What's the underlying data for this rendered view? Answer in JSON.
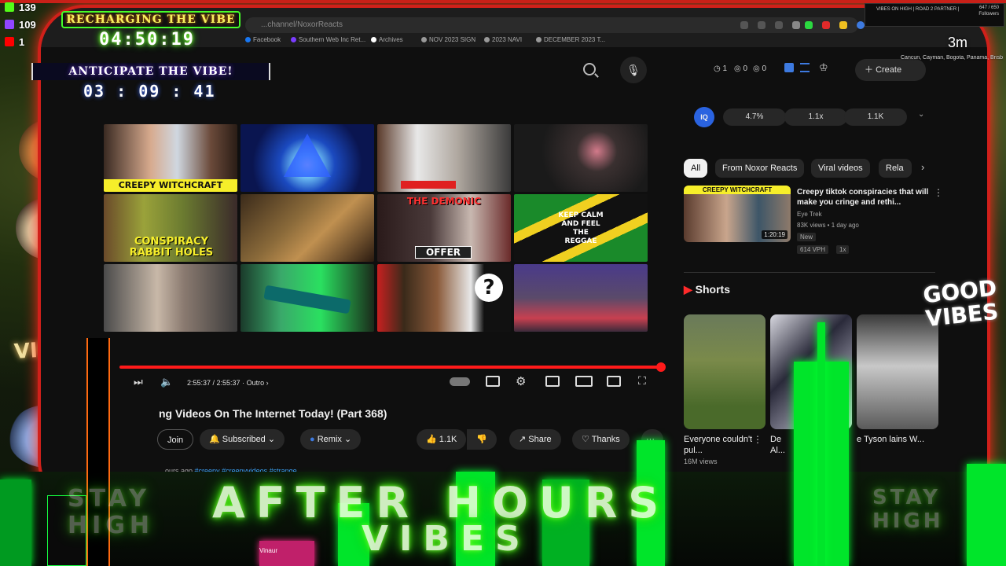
{
  "browser": {
    "url": "...channel/NoxorReacts",
    "bookmarks": [
      "Facebook",
      "Southern Web Inc Ret...",
      "Archives",
      "NOV 2023 SIGN",
      "2023 NAVI",
      "DECEMBER 2023 T..."
    ]
  },
  "youtube": {
    "header_stats": [
      "1",
      "0",
      "0"
    ],
    "create_label": "Create",
    "stat_pills": [
      "4.7%",
      "1.1x",
      "1.1K"
    ],
    "stats_avatar": "IQ"
  },
  "end_grid": {
    "captions": [
      "CREEPY WITCHCRAFT",
      "CONSPIRACY RABBIT HOLES",
      "THE DEMONIC",
      "OFFER",
      "KEEP CALM AND FEEL THE REGGAE",
      "?"
    ]
  },
  "player": {
    "time": "2:55:37 / 2:55:37",
    "chapter": "Outro"
  },
  "video": {
    "title": "ng Videos On The Internet Today! (Part 368)",
    "join_label": "Join",
    "subscribed_label": "Subscribed",
    "remix_label": "Remix",
    "like_count": "1.1K",
    "share_label": "Share",
    "thanks_label": "Thanks",
    "more_label": "···",
    "desc_prefix": "ours ago",
    "hashtags": "#creepy #creepyvideos #strange"
  },
  "sidebar": {
    "chips": [
      "All",
      "From Noxor Reacts",
      "Viral videos",
      "Rela"
    ],
    "rec": {
      "thumb_caption": "CREEPY WITCHCRAFT",
      "duration": "1:20:19",
      "title": "Creepy tiktok conspiracies that will make you cringe and rethi...",
      "channel": "Eye Trek",
      "views": "83K views • 1 day ago",
      "new_badge": "New",
      "vph": "614 VPH",
      "vph_x": "1x"
    },
    "shorts_label": "Shorts",
    "shorts": [
      {
        "title": "Everyone couldn't pul...",
        "views": "16M views"
      },
      {
        "title": "De Al...",
        "views": ""
      },
      {
        "title": "e Tyson lains W...",
        "views": ""
      }
    ]
  },
  "overlay": {
    "counters": [
      {
        "icon": "K",
        "value": "139",
        "color": "#53fc18"
      },
      {
        "icon": "twitch",
        "value": "109",
        "color": "#9146ff"
      },
      {
        "icon": "youtube",
        "value": "1",
        "color": "#ff0000"
      }
    ],
    "banner_top": "RECHARGING THE VIBE",
    "timer_top": "04:50:19",
    "banner_mid": "ANTICIPATE THE VIBE!",
    "timer_mid": "03 : 09 : 41",
    "top_right_time": "3m",
    "mini_title": "VIBES ON HIGH | ROAD 2 PARTNER |",
    "mini_stats": "647 / 650",
    "mini_followers": "Followers",
    "side_caption": "VIBES",
    "right_caption": "GOOD VIBES",
    "ticker": "Cancun, Cayman, Bogota, Panama, Brisbane...",
    "neon_line1": "AFTER HOURS",
    "neon_line2": "VIBES",
    "ghost_left": "STAY HIGH",
    "ghost_right": "STAY HIGH",
    "sub_label": "Vinaur"
  }
}
